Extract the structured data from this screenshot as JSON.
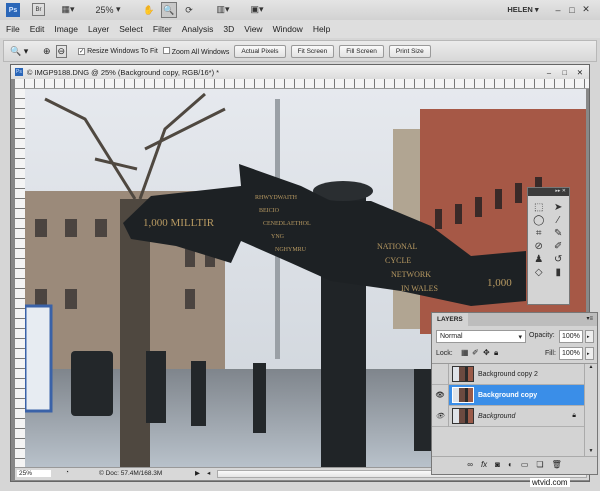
{
  "appbar": {
    "zoom": "25%",
    "workspace": "HELEN",
    "icons": [
      "ps-logo",
      "bridge-icon",
      "screen-mode-icon",
      "hand-icon",
      "zoom-icon",
      "rotate-view-icon",
      "arrange-icon",
      "screen-icon"
    ]
  },
  "menu": [
    "File",
    "Edit",
    "Image",
    "Layer",
    "Select",
    "Filter",
    "Analysis",
    "3D",
    "View",
    "Window",
    "Help"
  ],
  "options": {
    "resize_label": "Resize Windows To Fit",
    "resize_checked": "✓",
    "zoom_all_label": "Zoom All Windows",
    "buttons": [
      "Actual Pixels",
      "Fit Screen",
      "Fill Screen",
      "Print Size"
    ]
  },
  "document": {
    "title": "© IMGP9188.DNG @ 25% (Background copy, RGB/16*) *",
    "zoom": "25%",
    "doc_info": "© Doc: 57.4M/168.3M"
  },
  "photo": {
    "sign_left": "1,000 MILLTIR",
    "sign_welsh": [
      "RHWYDWAITH",
      "BEICIO",
      "CENEDLAETHOL",
      "YNG",
      "NGHYMRU"
    ],
    "sign_english": [
      "NATIONAL",
      "CYCLE",
      "NETWORK",
      "IN WALES"
    ],
    "sign_right": "1,000"
  },
  "layers": {
    "tab": "LAYERS",
    "blend": "Normal",
    "opacity_label": "Opacity:",
    "opacity": "100%",
    "lock_label": "Lock:",
    "fill_label": "Fill:",
    "fill": "100%",
    "items": [
      {
        "name": "Background copy 2",
        "visible": false,
        "selected": false
      },
      {
        "name": "Background copy",
        "visible": true,
        "selected": true
      },
      {
        "name": "Background",
        "visible": true,
        "selected": false,
        "locked": true
      }
    ]
  },
  "watermark": "wtvid.com",
  "colors": {
    "selected": "#3a8ee8"
  }
}
